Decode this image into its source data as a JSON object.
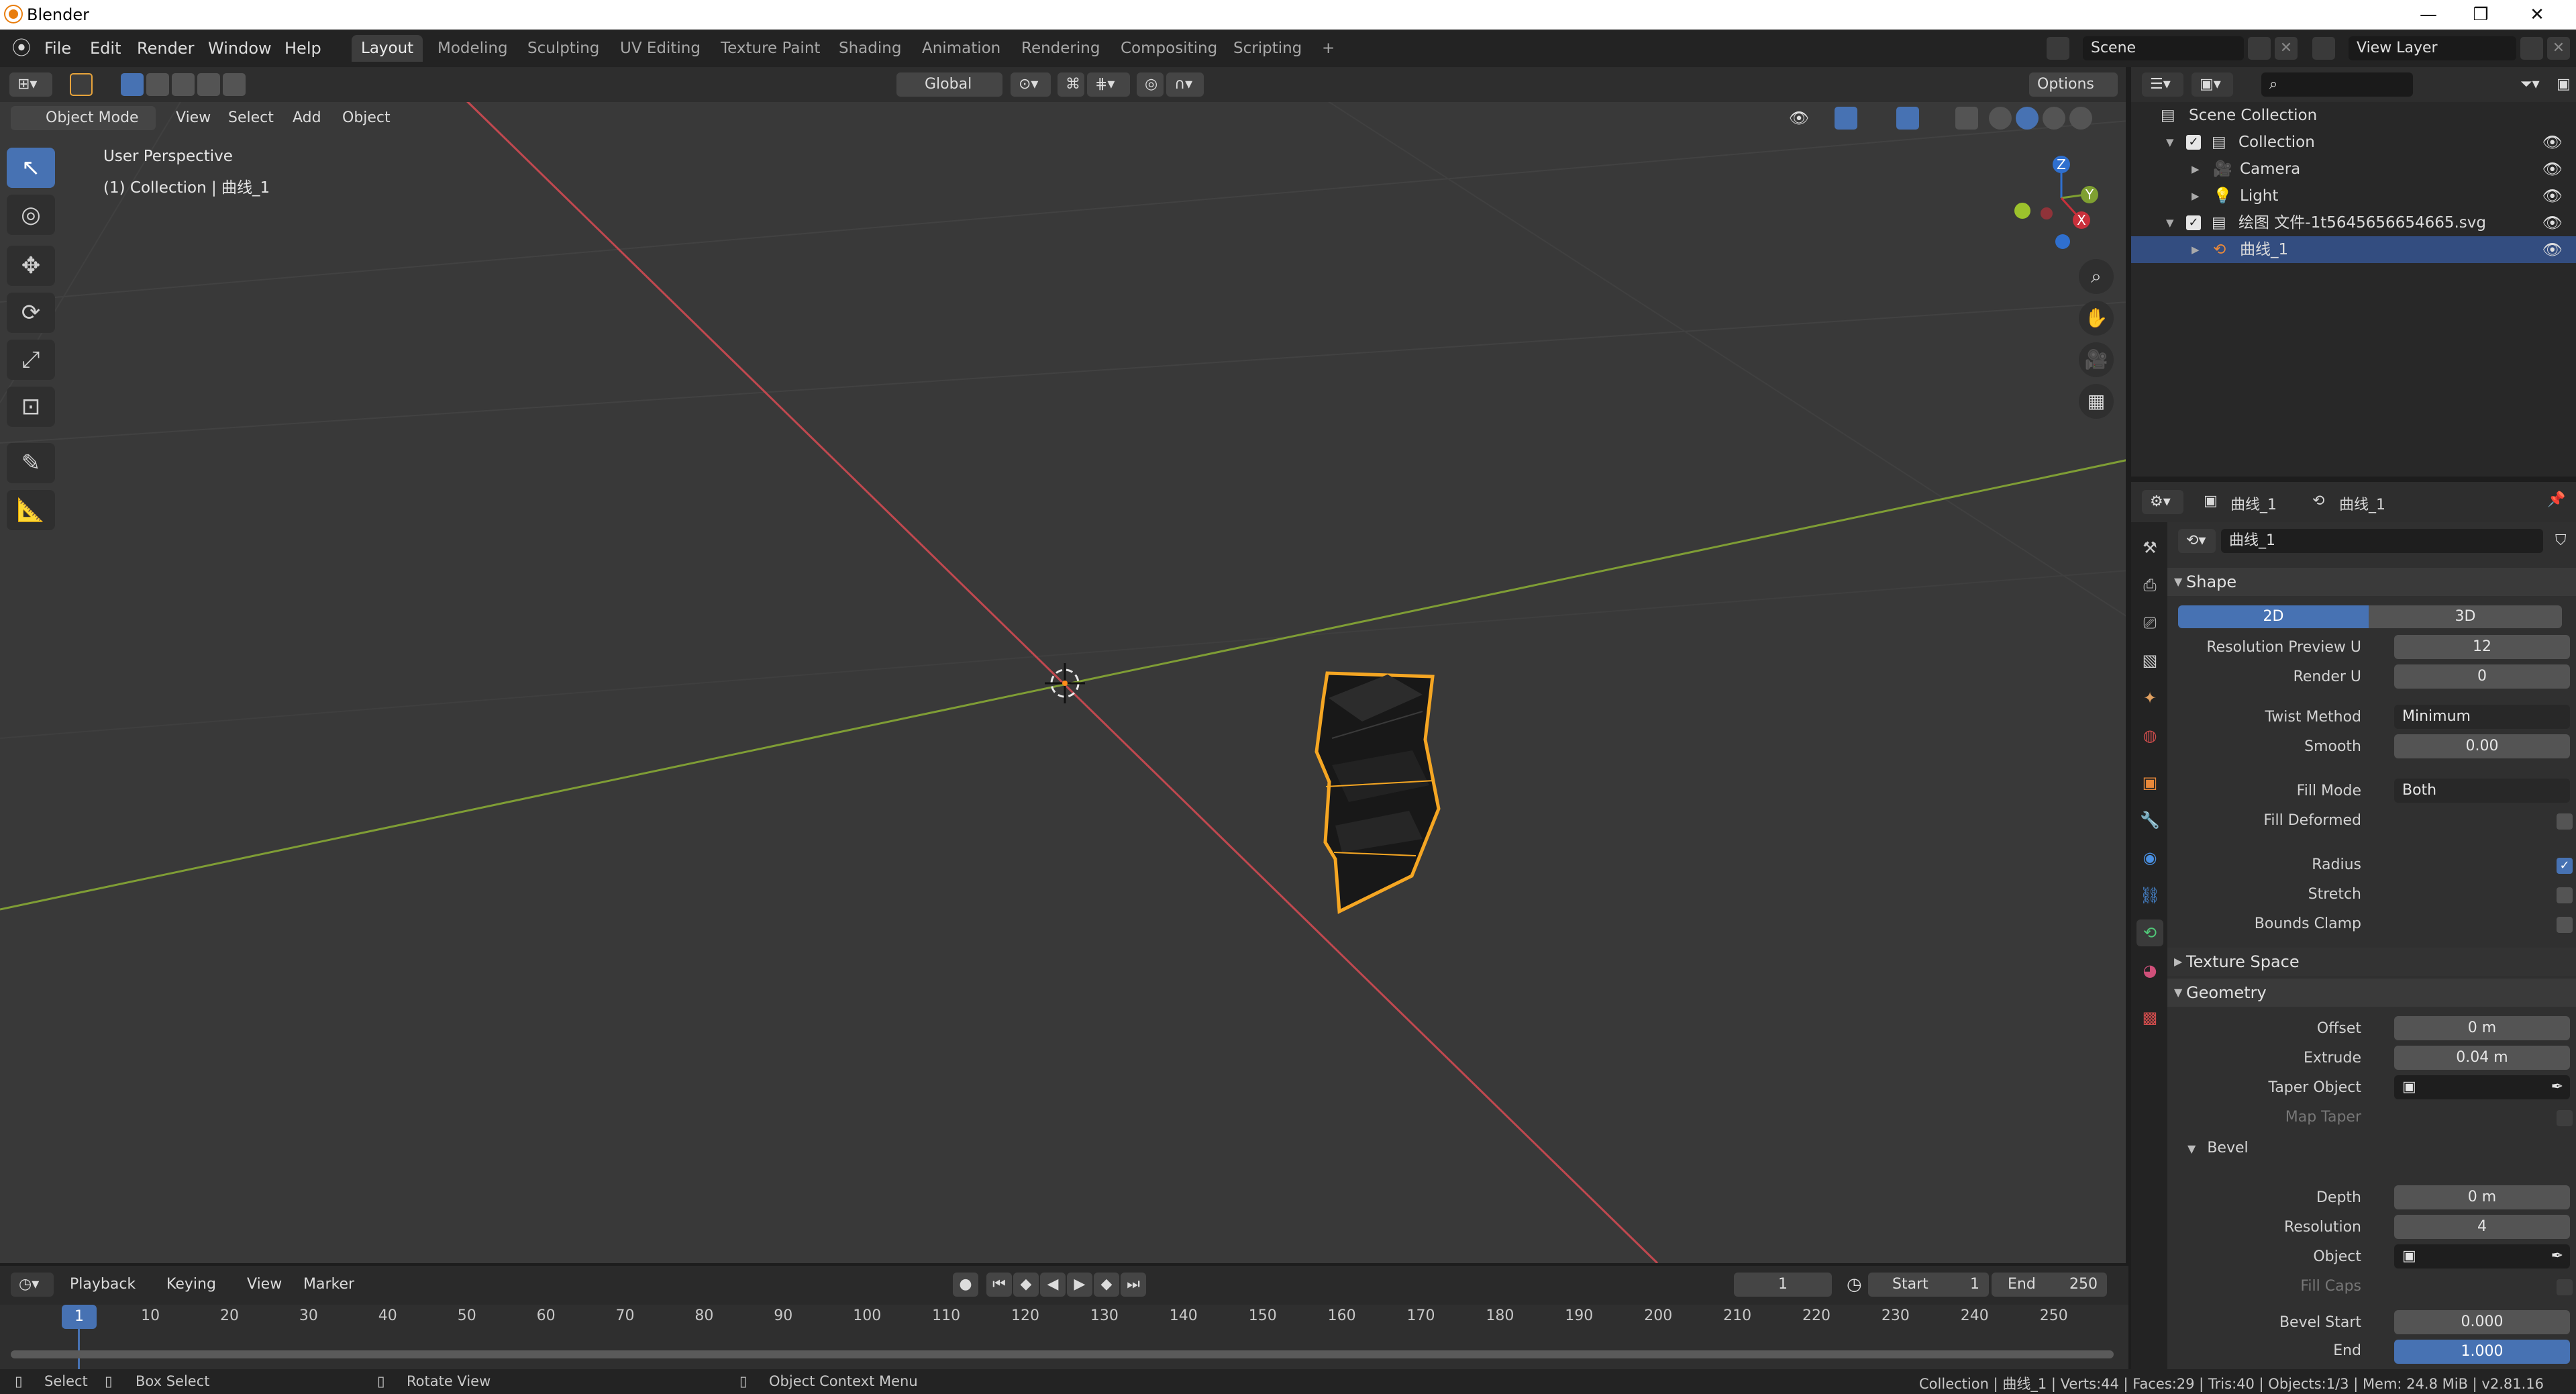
{
  "window": {
    "title": "Blender",
    "minimize": "—",
    "maximize": "❐",
    "close": "✕"
  },
  "menu": [
    "File",
    "Edit",
    "Render",
    "Window",
    "Help"
  ],
  "workspaces": [
    "Layout",
    "Modeling",
    "Sculpting",
    "UV Editing",
    "Texture Paint",
    "Shading",
    "Animation",
    "Rendering",
    "Compositing",
    "Scripting",
    "+"
  ],
  "scene": {
    "label": "Scene",
    "view_layer": "View Layer"
  },
  "viewport": {
    "transform_orientation": "Global",
    "options": "Options",
    "mode": "Object Mode",
    "header_menus": [
      "View",
      "Select",
      "Add",
      "Object"
    ],
    "perspective": "User Perspective",
    "collection_info": "(1) Collection | 曲线_1",
    "gizmo": {
      "z": "Z",
      "y": "Y",
      "x": "X"
    }
  },
  "timeline": {
    "menus": [
      "Playback",
      "Keying",
      "View",
      "Marker"
    ],
    "current_frame": "1",
    "start_label": "Start",
    "start": "1",
    "end_label": "End",
    "end": "250",
    "ticks": [
      "1",
      "10",
      "20",
      "30",
      "40",
      "50",
      "60",
      "70",
      "80",
      "90",
      "100",
      "110",
      "120",
      "130",
      "140",
      "150",
      "160",
      "170",
      "180",
      "190",
      "200",
      "210",
      "220",
      "230",
      "240",
      "250"
    ]
  },
  "statusbar": {
    "select": "Select",
    "box_select": "Box Select",
    "rotate": "Rotate View",
    "context": "Object Context Menu",
    "stats": "Collection | 曲线_1 | Verts:44 | Faces:29 | Tris:40 | Objects:1/3 | Mem: 24.8 MiB | v2.81.16"
  },
  "outliner": {
    "root": "Scene Collection",
    "rows": [
      {
        "name": "Collection",
        "indent": 1
      },
      {
        "name": "Camera",
        "indent": 2
      },
      {
        "name": "Light",
        "indent": 2
      },
      {
        "name": "绘图 文件-1t5645656654665.svg",
        "indent": 1
      },
      {
        "name": "曲线_1",
        "indent": 2
      }
    ]
  },
  "properties": {
    "breadcrumb_object": "曲线_1",
    "breadcrumb_data": "曲线_1",
    "datablock": "曲线_1",
    "shape": {
      "title": "Shape",
      "dim2d": "2D",
      "dim3d": "3D",
      "resolution_preview_u_label": "Resolution Preview U",
      "resolution_preview_u": "12",
      "render_u_label": "Render U",
      "render_u": "0",
      "twist_method_label": "Twist Method",
      "twist_method": "Minimum",
      "smooth_label": "Smooth",
      "smooth": "0.00",
      "fill_mode_label": "Fill Mode",
      "fill_mode": "Both",
      "fill_deformed_label": "Fill Deformed",
      "radius_label": "Radius",
      "stretch_label": "Stretch",
      "bounds_clamp_label": "Bounds Clamp"
    },
    "texture_space": "Texture Space",
    "geometry": {
      "title": "Geometry",
      "offset_label": "Offset",
      "offset": "0 m",
      "extrude_label": "Extrude",
      "extrude": "0.04 m",
      "taper_label": "Taper Object",
      "map_taper_label": "Map Taper"
    },
    "bevel": {
      "title": "Bevel",
      "depth_label": "Depth",
      "depth": "0 m",
      "resolution_label": "Resolution",
      "resolution": "4",
      "object_label": "Object",
      "fill_caps_label": "Fill Caps",
      "bevel_start_label": "Bevel Start",
      "bevel_start": "0.000",
      "end_label": "End",
      "end": "1.000"
    }
  }
}
